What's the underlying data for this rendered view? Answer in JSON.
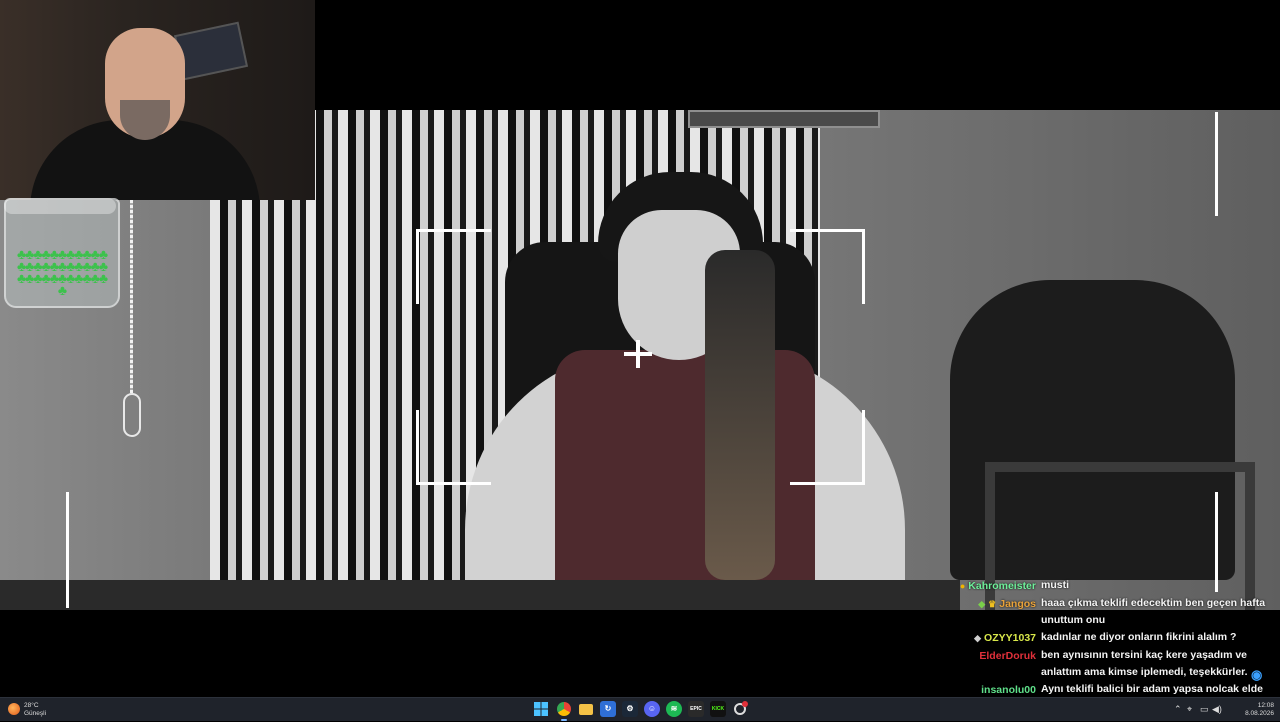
{
  "chat": {
    "messages": [
      {
        "badges": [
          "gold-coin-badge"
        ],
        "username": "Kahromeister",
        "color": "#6ef09a",
        "text": "musti"
      },
      {
        "badges": [
          "cat-badge",
          "crown-badge"
        ],
        "username": "Jangos",
        "color": "#e8a23a",
        "text": "haaa çıkma teklifi edecektim ben geçen hafta unuttum onu"
      },
      {
        "badges": [
          "cat-badge"
        ],
        "username": "OZYY1037",
        "color": "#d9e84a",
        "text": "kadınlar ne diyor onların fikrini alalım ?"
      },
      {
        "badges": [],
        "username": "ElderDoruk",
        "color": "#e0303a",
        "text": "ben aynısının tersini kaç kere yaşadım ve anlattım ama kimse iplemedi, teşekkürler."
      },
      {
        "badges": [],
        "username": "insanolu00",
        "color": "#5fe08a",
        "text": "Aynı teklifi balici bir adam yapsa nolcak elde baliyle"
      }
    ],
    "emote": "blue-globe-emote"
  },
  "taskbar": {
    "weather": {
      "temp": "28°C",
      "condition": "Güneşli"
    },
    "apps": [
      {
        "name": "start-button",
        "icon": "windows-logo"
      },
      {
        "name": "taskbar-chrome",
        "icon": "chrome",
        "active": true
      },
      {
        "name": "taskbar-file-explorer",
        "icon": "folder"
      },
      {
        "name": "taskbar-app-blue",
        "icon": "app"
      },
      {
        "name": "taskbar-steam",
        "icon": "steam"
      },
      {
        "name": "taskbar-discord",
        "icon": "discord"
      },
      {
        "name": "taskbar-spotify",
        "icon": "spotify"
      },
      {
        "name": "taskbar-epic-games",
        "icon": "EPIC"
      },
      {
        "name": "taskbar-kick",
        "icon": "KICK"
      },
      {
        "name": "taskbar-obs",
        "icon": "record"
      }
    ],
    "clock": {
      "time": "12:08",
      "date": "8.08.2026"
    }
  }
}
